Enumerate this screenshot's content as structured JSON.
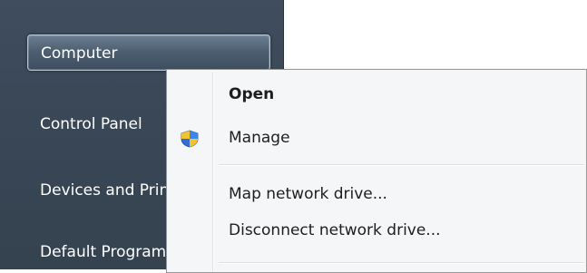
{
  "start_menu": {
    "items": [
      {
        "label": "Computer",
        "selected": true
      },
      {
        "label": "Control Panel",
        "selected": false
      },
      {
        "label": "Devices and Printers",
        "selected": false
      },
      {
        "label": "Default Programs",
        "selected": false
      }
    ]
  },
  "context_menu": {
    "items": [
      {
        "label": "Open",
        "bold": true
      },
      {
        "label": "Manage",
        "icon": "uac-shield-icon"
      },
      {
        "label": "Map network drive..."
      },
      {
        "label": "Disconnect network drive..."
      }
    ]
  },
  "colors": {
    "start_panel": "#3a4858",
    "menu_bg": "#f5f6f7",
    "menu_border": "#979797",
    "shield_blue": "#2f6fd1",
    "shield_yellow": "#f2c232"
  }
}
